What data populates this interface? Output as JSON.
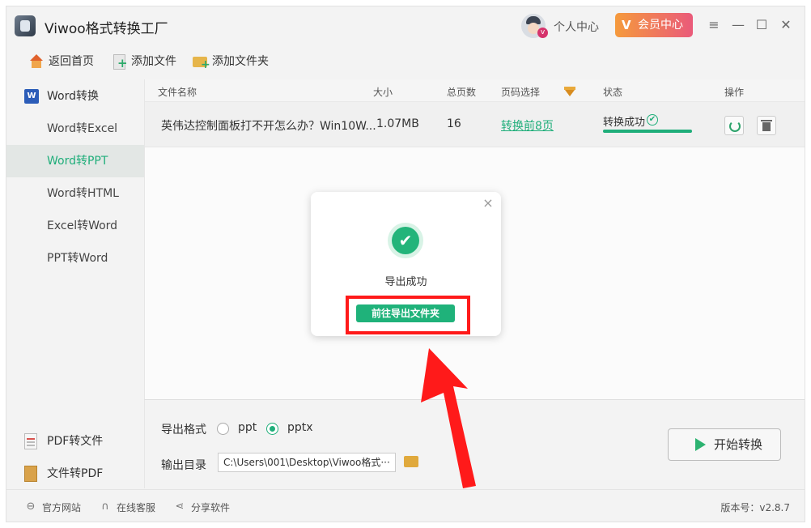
{
  "app": {
    "title": "Viwoo格式转换工厂"
  },
  "header": {
    "user_center": "个人中心",
    "vip_label": "会员中心",
    "vip_mark": "V",
    "avatar_badge": "v",
    "menu_icon": "≡",
    "minimize_icon": "—",
    "maximize_icon": "☐",
    "close_icon": "✕"
  },
  "toolbar": {
    "home": "返回首页",
    "add_file": "添加文件",
    "add_folder": "添加文件夹"
  },
  "sidebar": {
    "group_word": "Word转换",
    "word_icon_label": "W",
    "items": [
      {
        "label": "Word转Excel",
        "active": false
      },
      {
        "label": "Word转PPT",
        "active": true
      },
      {
        "label": "Word转HTML",
        "active": false
      },
      {
        "label": "Excel转Word",
        "active": false
      },
      {
        "label": "PPT转Word",
        "active": false
      }
    ],
    "pdf_convert": "PDF转文件",
    "file_to_pdf": "文件转PDF"
  },
  "table": {
    "headers": [
      "文件名称",
      "大小",
      "总页数",
      "页码选择",
      "状态",
      "操作"
    ],
    "rows": [
      {
        "name": "英伟达控制面板打不开怎么办？Win10W...",
        "size": "1.07MB",
        "pages": "16",
        "page_select": "转换前8页",
        "status": "转换成功",
        "progress_percent": 100
      }
    ]
  },
  "bottom": {
    "format_label": "导出格式",
    "format_options": [
      "ppt",
      "pptx"
    ],
    "format_selected": "pptx",
    "output_label": "输出目录",
    "output_path": "C:\\Users\\001\\Desktop\\Viwoo格式···",
    "start_button": "开始转换"
  },
  "statusbar": {
    "website": "官方网站",
    "support": "在线客服",
    "share": "分享软件",
    "version": "版本号：v2.8.7"
  },
  "modal": {
    "message": "导出成功",
    "button": "前往导出文件夹",
    "close_icon": "×",
    "check_icon": "✔"
  },
  "colors": {
    "accent": "#1fae7a",
    "highlight": "#ff1a1a",
    "vip_gradient_start": "#f59a3c",
    "vip_gradient_end": "#ea5a7a"
  }
}
